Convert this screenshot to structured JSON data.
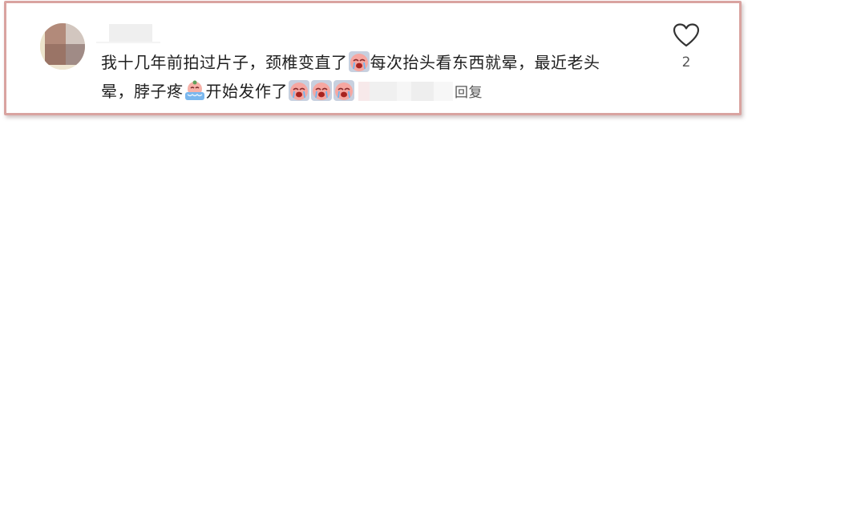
{
  "comment": {
    "line1": {
      "part1": "我十几年前拍过片子，颈椎变直了",
      "part2": "每次抬头看东西就晕，最近老头"
    },
    "line2": {
      "part1": "晕，脖子疼",
      "part2": "开始发作了"
    },
    "emojis": {
      "sob": "crying-peach-emoji",
      "tears": "sweating-tears-emoji"
    }
  },
  "actions": {
    "reply_label": "回复",
    "like_count": "2",
    "like_icon": "heart-outline-icon"
  },
  "colors": {
    "card_border": "#d9a3a0",
    "text": "#1f1f1f",
    "secondary_text": "#555555"
  }
}
